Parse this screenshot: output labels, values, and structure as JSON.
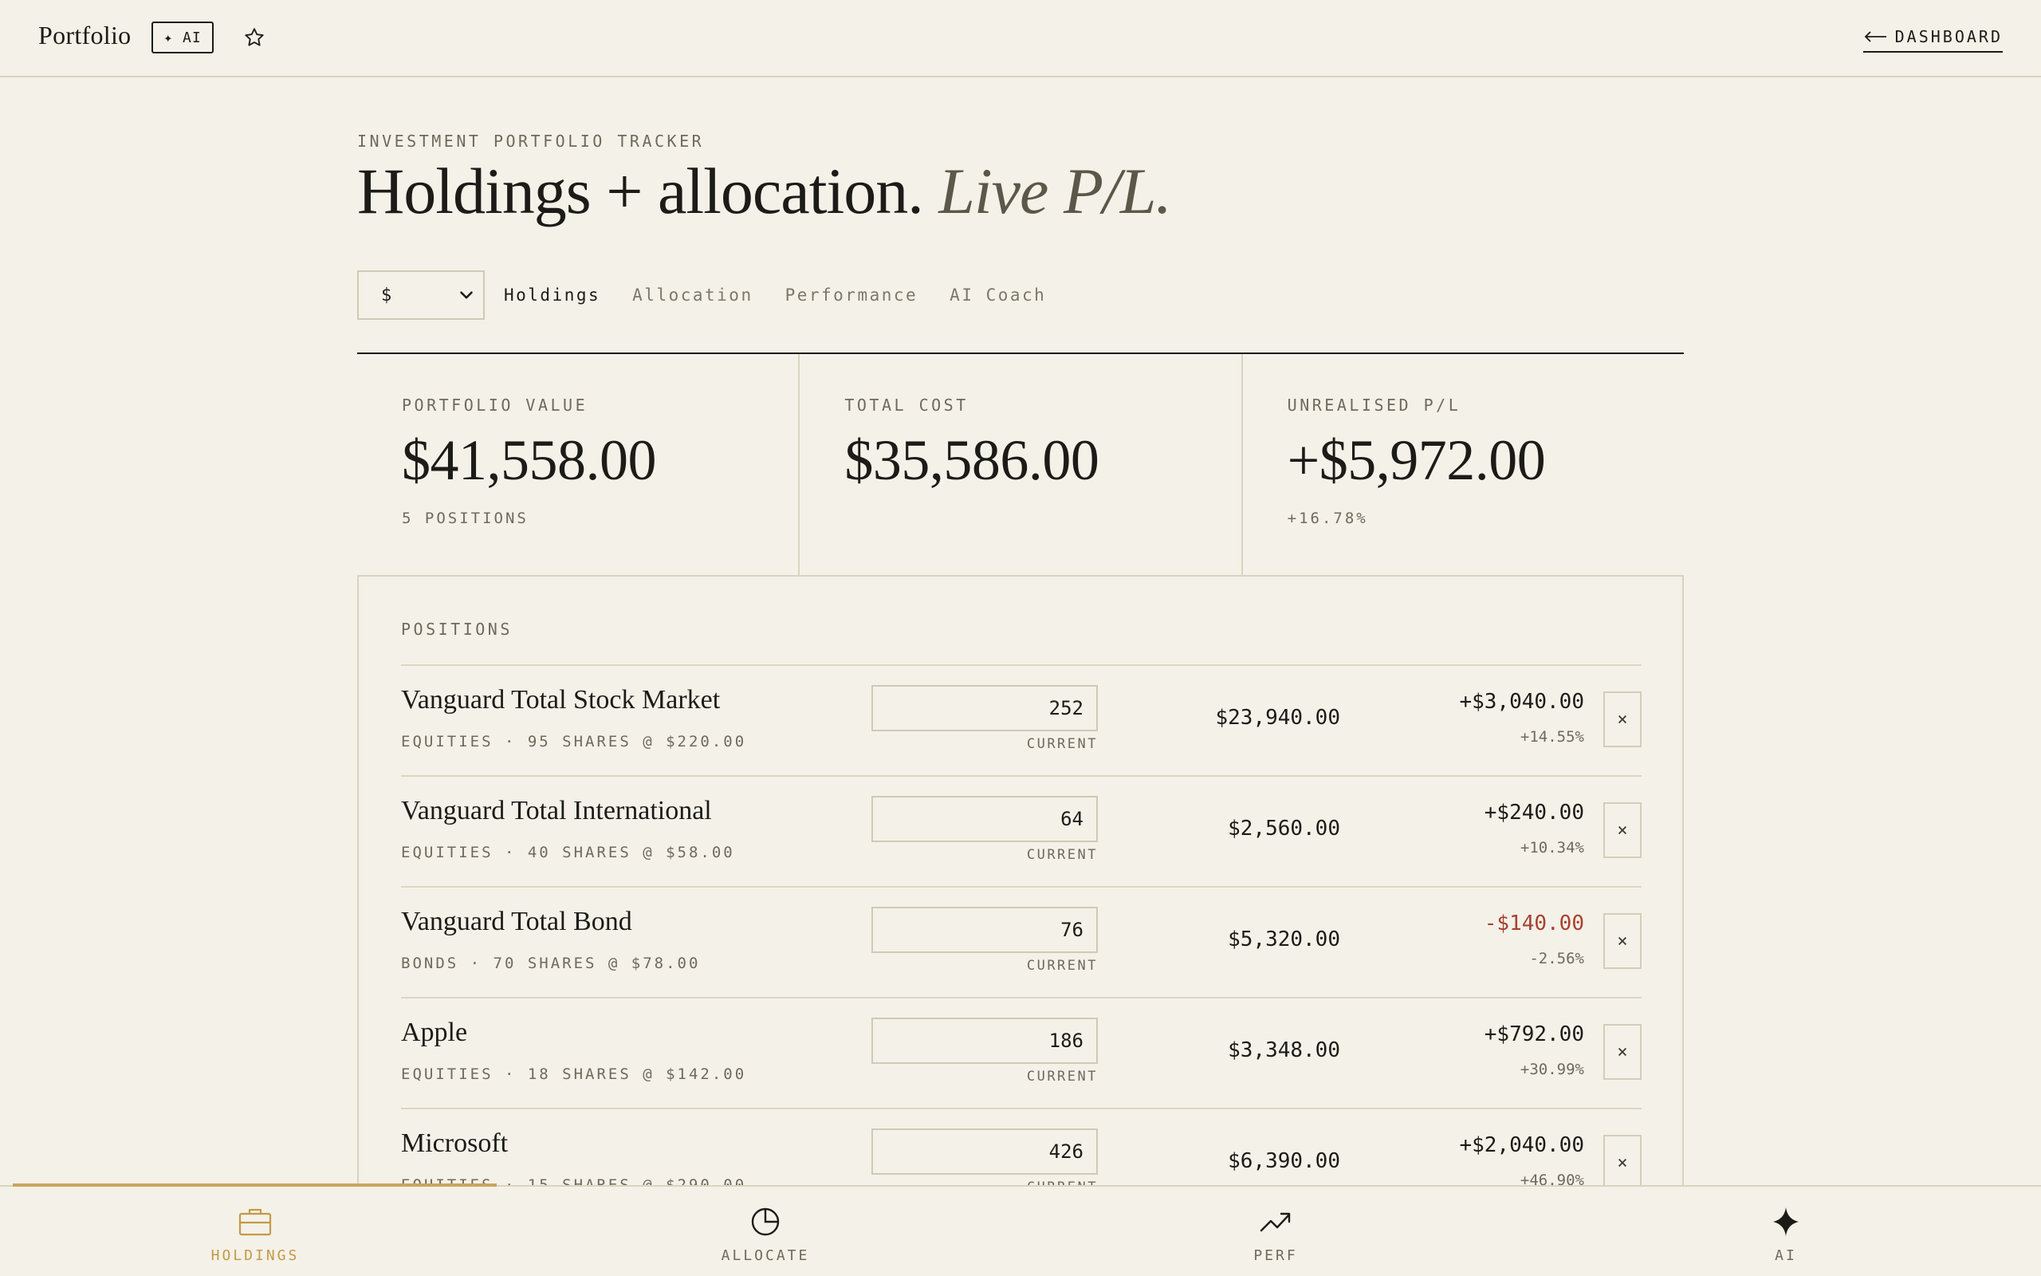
{
  "header": {
    "brand": "Portfolio",
    "ai_chip": "✦ AI",
    "back_link": "DASHBOARD"
  },
  "page": {
    "eyebrow": "INVESTMENT PORTFOLIO TRACKER",
    "title": "Holdings + allocation.",
    "title_italic": "Live P/L."
  },
  "controls": {
    "currency": "$",
    "tabs": [
      "Holdings",
      "Allocation",
      "Performance",
      "AI Coach"
    ],
    "active_tab": "Holdings"
  },
  "stats": [
    {
      "label": "PORTFOLIO VALUE",
      "value": "$41,558.00",
      "sub": "5 POSITIONS"
    },
    {
      "label": "TOTAL COST",
      "value": "$35,586.00",
      "sub": ""
    },
    {
      "label": "UNREALISED P/L",
      "value": "+$5,972.00",
      "sub": "+16.78%"
    }
  ],
  "positions": {
    "title": "POSITIONS",
    "price_caption": "CURRENT",
    "remove_label": "×",
    "rows": [
      {
        "name": "Vanguard Total Stock Market",
        "meta": "EQUITIES · 95 SHARES @ $220.00",
        "price": "252",
        "value": "$23,940.00",
        "pl": "+$3,040.00",
        "pct": "+14.55%"
      },
      {
        "name": "Vanguard Total International",
        "meta": "EQUITIES · 40 SHARES @ $58.00",
        "price": "64",
        "value": "$2,560.00",
        "pl": "+$240.00",
        "pct": "+10.34%"
      },
      {
        "name": "Vanguard Total Bond",
        "meta": "BONDS · 70 SHARES @ $78.00",
        "price": "76",
        "value": "$5,320.00",
        "pl": "-$140.00",
        "pct": "-2.56%"
      },
      {
        "name": "Apple",
        "meta": "EQUITIES · 18 SHARES @ $142.00",
        "price": "186",
        "value": "$3,348.00",
        "pl": "+$792.00",
        "pct": "+30.99%"
      },
      {
        "name": "Microsoft",
        "meta": "EQUITIES · 15 SHARES @ $290.00",
        "price": "426",
        "value": "$6,390.00",
        "pl": "+$2,040.00",
        "pct": "+46.90%"
      }
    ]
  },
  "bottom_nav": {
    "items": [
      {
        "label": "HOLDINGS",
        "icon": "briefcase-icon"
      },
      {
        "label": "ALLOCATE",
        "icon": "pie-chart-icon"
      },
      {
        "label": "PERF",
        "icon": "trending-up-icon"
      },
      {
        "label": "AI",
        "icon": "sparkle-icon"
      }
    ],
    "active": "HOLDINGS",
    "accent": "#c49a45"
  },
  "colors": {
    "background": "#f4f1e8",
    "negative": "#a7412f",
    "accent": "#c9a55c"
  }
}
